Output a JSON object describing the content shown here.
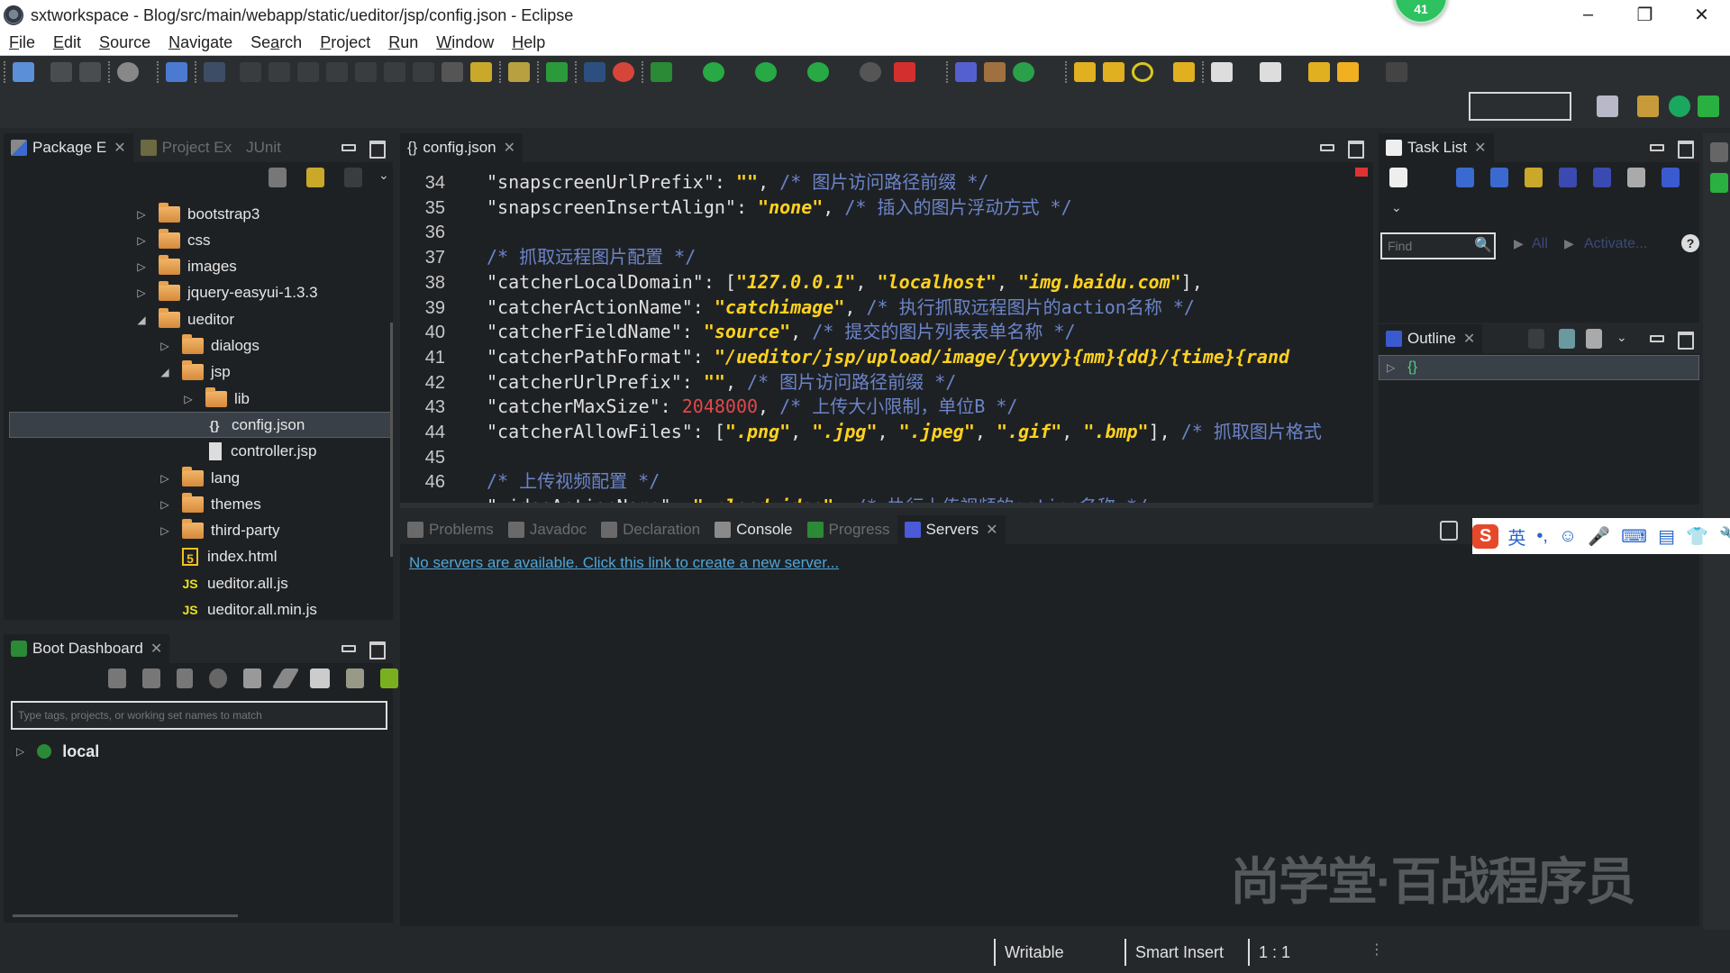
{
  "window": {
    "title": "sxtworkspace - Blog/src/main/webapp/static/ueditor/jsp/config.json - Eclipse",
    "notification_badge": "41",
    "controls": {
      "minimize": "–",
      "restore": "❐",
      "close": "✕"
    }
  },
  "menubar": {
    "items": [
      {
        "label": "File",
        "mnemonic": "F"
      },
      {
        "label": "Edit",
        "mnemonic": "E"
      },
      {
        "label": "Source",
        "mnemonic": "S"
      },
      {
        "label": "Navigate",
        "mnemonic": "N"
      },
      {
        "label": "Search",
        "mnemonic": "a"
      },
      {
        "label": "Project",
        "mnemonic": "P"
      },
      {
        "label": "Run",
        "mnemonic": "R"
      },
      {
        "label": "Window",
        "mnemonic": "W"
      },
      {
        "label": "Help",
        "mnemonic": "H"
      }
    ]
  },
  "package_explorer": {
    "tabs": [
      {
        "label": "Package E",
        "active": true
      },
      {
        "label": "Project Ex",
        "active": false
      },
      {
        "label": "JUnit",
        "active": false
      }
    ],
    "tree": [
      {
        "label": "bootstrap3",
        "type": "folder",
        "depth": 0,
        "expanded": false
      },
      {
        "label": "css",
        "type": "folder",
        "depth": 0,
        "expanded": false
      },
      {
        "label": "images",
        "type": "folder",
        "depth": 0,
        "expanded": false
      },
      {
        "label": "jquery-easyui-1.3.3",
        "type": "folder",
        "depth": 0,
        "expanded": false
      },
      {
        "label": "ueditor",
        "type": "folder",
        "depth": 0,
        "expanded": true
      },
      {
        "label": "dialogs",
        "type": "folder",
        "depth": 1,
        "expanded": false
      },
      {
        "label": "jsp",
        "type": "folder",
        "depth": 1,
        "expanded": true
      },
      {
        "label": "lib",
        "type": "folder",
        "depth": 2,
        "expanded": false
      },
      {
        "label": "config.json",
        "type": "json",
        "depth": 2,
        "selected": true
      },
      {
        "label": "controller.jsp",
        "type": "file",
        "depth": 2
      },
      {
        "label": "lang",
        "type": "folder",
        "depth": 1,
        "expanded": false
      },
      {
        "label": "themes",
        "type": "folder",
        "depth": 1,
        "expanded": false
      },
      {
        "label": "third-party",
        "type": "folder",
        "depth": 1,
        "expanded": false
      },
      {
        "label": "index.html",
        "type": "html",
        "depth": 1
      },
      {
        "label": "ueditor.all.js",
        "type": "js",
        "depth": 1
      },
      {
        "label": "ueditor.all.min.js",
        "type": "js",
        "depth": 1
      }
    ]
  },
  "boot_dashboard": {
    "tab_label": "Boot Dashboard",
    "filter_placeholder": "Type tags, projects, or working set names to match",
    "items": [
      {
        "label": "local"
      }
    ]
  },
  "editor": {
    "tab_label": "config.json",
    "lines": [
      {
        "n": "34",
        "parts": [
          [
            "key",
            "\"snapscreenUrlPrefix\""
          ],
          [
            "punc",
            ": "
          ],
          [
            "str",
            "\"\""
          ],
          [
            "punc",
            ", "
          ],
          [
            "cmt",
            "/* 图片访问路径前缀 */"
          ]
        ]
      },
      {
        "n": "35",
        "parts": [
          [
            "key",
            "\"snapscreenInsertAlign\""
          ],
          [
            "punc",
            ": "
          ],
          [
            "str",
            "\"none\""
          ],
          [
            "punc",
            ", "
          ],
          [
            "cmt",
            "/* 插入的图片浮动方式 */"
          ]
        ]
      },
      {
        "n": "36",
        "parts": []
      },
      {
        "n": "37",
        "parts": [
          [
            "cmt",
            "/* 抓取远程图片配置 */"
          ]
        ]
      },
      {
        "n": "38",
        "parts": [
          [
            "key",
            "\"catcherLocalDomain\""
          ],
          [
            "punc",
            ": ["
          ],
          [
            "str",
            "\"127.0.0.1\""
          ],
          [
            "punc",
            ", "
          ],
          [
            "str",
            "\"localhost\""
          ],
          [
            "punc",
            ", "
          ],
          [
            "str",
            "\"img.baidu.com\""
          ],
          [
            "punc",
            "],"
          ]
        ]
      },
      {
        "n": "39",
        "parts": [
          [
            "key",
            "\"catcherActionName\""
          ],
          [
            "punc",
            ": "
          ],
          [
            "str",
            "\"catchimage\""
          ],
          [
            "punc",
            ", "
          ],
          [
            "cmt",
            "/* 执行抓取远程图片的action名称 */"
          ]
        ]
      },
      {
        "n": "40",
        "parts": [
          [
            "key",
            "\"catcherFieldName\""
          ],
          [
            "punc",
            ": "
          ],
          [
            "str",
            "\"source\""
          ],
          [
            "punc",
            ", "
          ],
          [
            "cmt",
            "/* 提交的图片列表表单名称 */"
          ]
        ]
      },
      {
        "n": "41",
        "parts": [
          [
            "key",
            "\"catcherPathFormat\""
          ],
          [
            "punc",
            ": "
          ],
          [
            "str",
            "\"/ueditor/jsp/upload/image/{yyyy}{mm}{dd}/{time}{rand"
          ]
        ]
      },
      {
        "n": "42",
        "parts": [
          [
            "key",
            "\"catcherUrlPrefix\""
          ],
          [
            "punc",
            ": "
          ],
          [
            "str",
            "\"\""
          ],
          [
            "punc",
            ", "
          ],
          [
            "cmt",
            "/* 图片访问路径前缀 */"
          ]
        ]
      },
      {
        "n": "43",
        "parts": [
          [
            "key",
            "\"catcherMaxSize\""
          ],
          [
            "punc",
            ": "
          ],
          [
            "num",
            "2048000"
          ],
          [
            "punc",
            ", "
          ],
          [
            "cmt",
            "/* 上传大小限制，单位B */"
          ]
        ]
      },
      {
        "n": "44",
        "parts": [
          [
            "key",
            "\"catcherAllowFiles\""
          ],
          [
            "punc",
            ": ["
          ],
          [
            "str",
            "\".png\""
          ],
          [
            "punc",
            ", "
          ],
          [
            "str",
            "\".jpg\""
          ],
          [
            "punc",
            ", "
          ],
          [
            "str",
            "\".jpeg\""
          ],
          [
            "punc",
            ", "
          ],
          [
            "str",
            "\".gif\""
          ],
          [
            "punc",
            ", "
          ],
          [
            "str",
            "\".bmp\""
          ],
          [
            "punc",
            "], "
          ],
          [
            "cmt",
            "/* 抓取图片格式"
          ]
        ]
      },
      {
        "n": "45",
        "parts": []
      },
      {
        "n": "46",
        "parts": [
          [
            "cmt",
            "/* 上传视频配置 */"
          ]
        ]
      },
      {
        "n": "",
        "parts": [
          [
            "key",
            "\"videoActionName\""
          ],
          [
            "punc",
            ": "
          ],
          [
            "str",
            "\"uploadvideo\""
          ],
          [
            "punc",
            ", "
          ],
          [
            "cmt",
            "/* 执行上传视频的action名称 */"
          ]
        ]
      }
    ]
  },
  "task_list": {
    "tab_label": "Task List",
    "find_placeholder": "Find",
    "filter_all": "All",
    "filter_activate": "Activate..."
  },
  "outline": {
    "tab_label": "Outline",
    "root_node": "{}"
  },
  "bottom_panel": {
    "tabs": [
      {
        "label": "Problems",
        "active": false
      },
      {
        "label": "Javadoc",
        "active": false
      },
      {
        "label": "Declaration",
        "active": false
      },
      {
        "label": "Console",
        "active": false
      },
      {
        "label": "Progress",
        "active": false
      },
      {
        "label": "Servers",
        "active": true
      }
    ],
    "servers_message": "No servers are available. Click this link to create a new server..."
  },
  "ime_bar": {
    "items": [
      "S",
      "英",
      "•,",
      "☺",
      "🎤",
      "⌨",
      "▤",
      "👕",
      "🔧"
    ]
  },
  "statusbar": {
    "writable": "Writable",
    "insert_mode": "Smart Insert",
    "position": "1 : 1"
  },
  "watermark": "尚学堂·百战程序员"
}
